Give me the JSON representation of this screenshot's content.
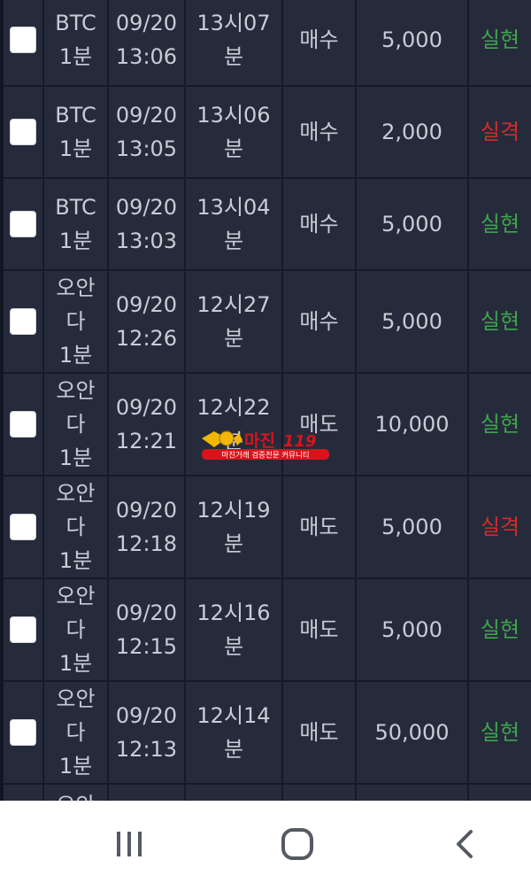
{
  "rows": [
    {
      "symbol": [
        "BTC",
        "1분"
      ],
      "date": "09/20",
      "time_hm": "13:06",
      "round": [
        "13시07",
        "분"
      ],
      "side": "매수",
      "amount": "5,000",
      "result": "실현",
      "result_type": "win"
    },
    {
      "symbol": [
        "BTC",
        "1분"
      ],
      "date": "09/20",
      "time_hm": "13:05",
      "round": [
        "13시06",
        "분"
      ],
      "side": "매수",
      "amount": "2,000",
      "result": "실격",
      "result_type": "loss"
    },
    {
      "symbol": [
        "BTC",
        "1분"
      ],
      "date": "09/20",
      "time_hm": "13:03",
      "round": [
        "13시04",
        "분"
      ],
      "side": "매수",
      "amount": "5,000",
      "result": "실현",
      "result_type": "win"
    },
    {
      "symbol": [
        "오안",
        "다",
        "1분"
      ],
      "date": "09/20",
      "time_hm": "12:26",
      "round": [
        "12시27",
        "분"
      ],
      "side": "매수",
      "amount": "5,000",
      "result": "실현",
      "result_type": "win"
    },
    {
      "symbol": [
        "오안",
        "다",
        "1분"
      ],
      "date": "09/20",
      "time_hm": "12:21",
      "round": [
        "12시22",
        "분"
      ],
      "side": "매도",
      "amount": "10,000",
      "result": "실현",
      "result_type": "win"
    },
    {
      "symbol": [
        "오안",
        "다",
        "1분"
      ],
      "date": "09/20",
      "time_hm": "12:18",
      "round": [
        "12시19",
        "분"
      ],
      "side": "매도",
      "amount": "5,000",
      "result": "실격",
      "result_type": "loss"
    },
    {
      "symbol": [
        "오안",
        "다",
        "1분"
      ],
      "date": "09/20",
      "time_hm": "12:15",
      "round": [
        "12시16",
        "분"
      ],
      "side": "매도",
      "amount": "5,000",
      "result": "실현",
      "result_type": "win"
    },
    {
      "symbol": [
        "오안",
        "다",
        "1분"
      ],
      "date": "09/20",
      "time_hm": "12:13",
      "round": [
        "12시14",
        "분"
      ],
      "side": "매도",
      "amount": "50,000",
      "result": "실현",
      "result_type": "win"
    }
  ],
  "partial_row": {
    "symbol": "오안"
  },
  "watermark": {
    "title": "마진",
    "badge": "119",
    "subtitle": "마진거래 검증전문 커뮤니티"
  },
  "colors": {
    "win": "#3fa34d",
    "loss": "#d22c2c",
    "background": "#262b3b",
    "grid": "#161a27",
    "watermark_red": "#d7141c",
    "watermark_gold": "#f2b705"
  },
  "nav": {
    "recent_icon": "recent-apps-icon",
    "home_icon": "home-icon",
    "back_icon": "back-icon"
  }
}
